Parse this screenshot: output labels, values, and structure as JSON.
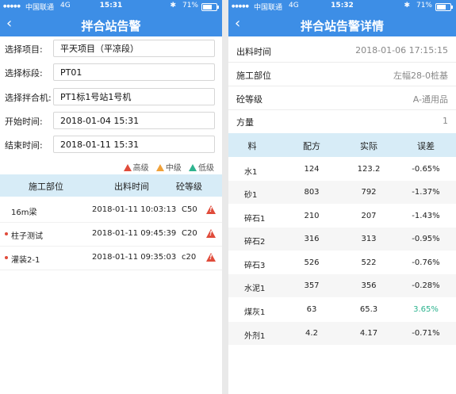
{
  "status_bar": {
    "left_phone": {
      "signal": "●●●●●",
      "carrier": "中国联通",
      "network": "4G",
      "time": "15:31",
      "bluetooth": "✱",
      "battery": "71%"
    },
    "right_phone": {
      "signal": "●●●●●",
      "carrier": "中国联通",
      "network": "4G",
      "time": "15:32",
      "bluetooth": "✱",
      "battery": "71%"
    }
  },
  "left": {
    "title": "拌合站告警",
    "back": "‹",
    "filters": [
      {
        "label": "选择项目:",
        "value": "平天项目（平凉段）"
      },
      {
        "label": "选择标段:",
        "value": "PT01"
      },
      {
        "label": "选择拌合机:",
        "value": "PT1标1号站1号机"
      },
      {
        "label": "开始时间:",
        "value": "2018-01-04 15:31"
      },
      {
        "label": "结束时间:",
        "value": "2018-01-11 15:31"
      }
    ],
    "legend": {
      "high": "高级",
      "mid": "中级",
      "low": "低级"
    },
    "table": {
      "headers": [
        "施工部位",
        "出料时间",
        "砼等级"
      ],
      "rows": [
        {
          "part": "16m梁",
          "time": "2018-01-11 10:03:13",
          "grade": "C50",
          "dot": false
        },
        {
          "part": "柱子测试",
          "time": "2018-01-11 09:45:39",
          "grade": "C20",
          "dot": true
        },
        {
          "part": "灌装2-1",
          "time": "2018-01-11 09:35:03",
          "grade": "c20",
          "dot": true
        }
      ]
    }
  },
  "right": {
    "title": "拌合站告警详情",
    "back": "‹",
    "details": [
      {
        "label": "出料时间",
        "value": "2018-01-06 17:15:15"
      },
      {
        "label": "施工部位",
        "value": "左幅28-0桩基"
      },
      {
        "label": "砼等级",
        "value": "A-通用品"
      },
      {
        "label": "方量",
        "value": "1"
      }
    ],
    "table": {
      "headers": [
        "料",
        "配方",
        "实际",
        "误差"
      ],
      "rows": [
        {
          "material": "水1",
          "recipe": "124",
          "actual": "123.2",
          "error": "-0.65%"
        },
        {
          "material": "砂1",
          "recipe": "803",
          "actual": "792",
          "error": "-1.37%"
        },
        {
          "material": "碎石1",
          "recipe": "210",
          "actual": "207",
          "error": "-1.43%"
        },
        {
          "material": "碎石2",
          "recipe": "316",
          "actual": "313",
          "error": "-0.95%"
        },
        {
          "material": "碎石3",
          "recipe": "526",
          "actual": "522",
          "error": "-0.76%"
        },
        {
          "material": "水泥1",
          "recipe": "357",
          "actual": "356",
          "error": "-0.28%"
        },
        {
          "material": "煤灰1",
          "recipe": "63",
          "actual": "65.3",
          "error": "3.65%"
        },
        {
          "material": "外剂1",
          "recipe": "4.2",
          "actual": "4.17",
          "error": "-0.71%"
        }
      ]
    }
  },
  "colors": {
    "header_blue": "#3d8ee6",
    "table_head": "#d7ecf7",
    "alert_red": "#e04b3a",
    "alert_orange": "#f0a13a",
    "alert_green": "#2fb38f",
    "positive_error": "#2bb38e"
  }
}
